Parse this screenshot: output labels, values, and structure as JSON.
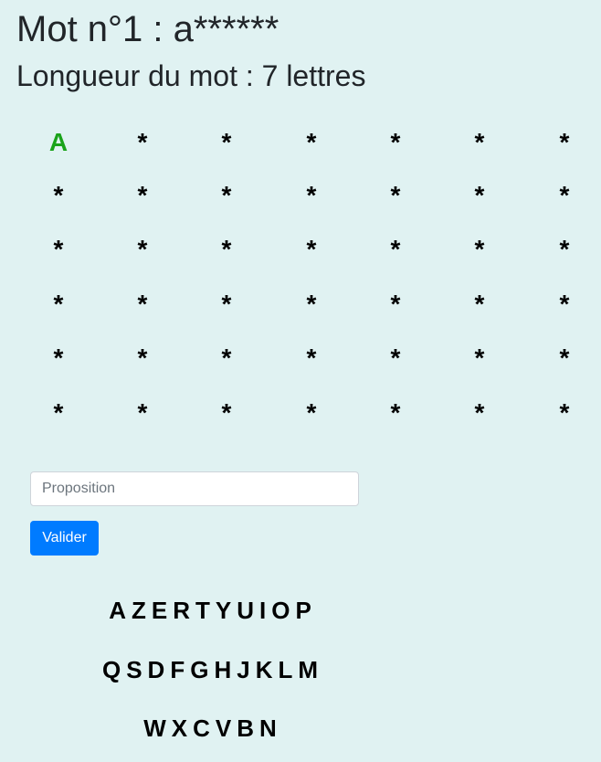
{
  "header": {
    "title": "Mot n°1 : a******",
    "subtitle": "Longueur du mot : 7 lettres"
  },
  "grid": {
    "rows": [
      [
        {
          "char": "A",
          "state": "correct"
        },
        {
          "char": "*",
          "state": "hidden"
        },
        {
          "char": "*",
          "state": "hidden"
        },
        {
          "char": "*",
          "state": "hidden"
        },
        {
          "char": "*",
          "state": "hidden"
        },
        {
          "char": "*",
          "state": "hidden"
        },
        {
          "char": "*",
          "state": "hidden"
        }
      ],
      [
        {
          "char": "*",
          "state": "hidden"
        },
        {
          "char": "*",
          "state": "hidden"
        },
        {
          "char": "*",
          "state": "hidden"
        },
        {
          "char": "*",
          "state": "hidden"
        },
        {
          "char": "*",
          "state": "hidden"
        },
        {
          "char": "*",
          "state": "hidden"
        },
        {
          "char": "*",
          "state": "hidden"
        }
      ],
      [
        {
          "char": "*",
          "state": "hidden"
        },
        {
          "char": "*",
          "state": "hidden"
        },
        {
          "char": "*",
          "state": "hidden"
        },
        {
          "char": "*",
          "state": "hidden"
        },
        {
          "char": "*",
          "state": "hidden"
        },
        {
          "char": "*",
          "state": "hidden"
        },
        {
          "char": "*",
          "state": "hidden"
        }
      ],
      [
        {
          "char": "*",
          "state": "hidden"
        },
        {
          "char": "*",
          "state": "hidden"
        },
        {
          "char": "*",
          "state": "hidden"
        },
        {
          "char": "*",
          "state": "hidden"
        },
        {
          "char": "*",
          "state": "hidden"
        },
        {
          "char": "*",
          "state": "hidden"
        },
        {
          "char": "*",
          "state": "hidden"
        }
      ],
      [
        {
          "char": "*",
          "state": "hidden"
        },
        {
          "char": "*",
          "state": "hidden"
        },
        {
          "char": "*",
          "state": "hidden"
        },
        {
          "char": "*",
          "state": "hidden"
        },
        {
          "char": "*",
          "state": "hidden"
        },
        {
          "char": "*",
          "state": "hidden"
        },
        {
          "char": "*",
          "state": "hidden"
        }
      ],
      [
        {
          "char": "*",
          "state": "hidden"
        },
        {
          "char": "*",
          "state": "hidden"
        },
        {
          "char": "*",
          "state": "hidden"
        },
        {
          "char": "*",
          "state": "hidden"
        },
        {
          "char": "*",
          "state": "hidden"
        },
        {
          "char": "*",
          "state": "hidden"
        },
        {
          "char": "*",
          "state": "hidden"
        }
      ]
    ]
  },
  "form": {
    "input_value": "",
    "input_placeholder": "Proposition",
    "submit_label": "Valider"
  },
  "keyboard": {
    "rows": [
      [
        "A",
        "Z",
        "E",
        "R",
        "T",
        "Y",
        "U",
        "I",
        "O",
        "P"
      ],
      [
        "Q",
        "S",
        "D",
        "F",
        "G",
        "H",
        "J",
        "K",
        "L",
        "M"
      ],
      [
        "W",
        "X",
        "C",
        "V",
        "B",
        "N"
      ]
    ]
  },
  "colors": {
    "background": "#e0f2f2",
    "correct_letter": "#1aa31a",
    "button": "#007bff"
  }
}
